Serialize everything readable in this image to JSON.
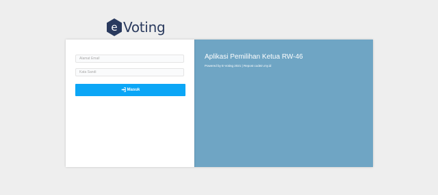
{
  "brand": {
    "logo_letter": "e",
    "name": "Voting",
    "logo_color": "#2a3a5e"
  },
  "login_form": {
    "email_placeholder": "Alamat Email",
    "password_placeholder": "Kata Sandi",
    "submit_label": "Masuk",
    "submit_icon": "sign-in-icon",
    "submit_color": "#0ba6f6"
  },
  "info_panel": {
    "title": "Aplikasi Pemilihan Ketua RW-46",
    "subtitle": "Powered by E-Voting 2021 | Repost codein.my.id",
    "background": "#6fa5c4"
  }
}
